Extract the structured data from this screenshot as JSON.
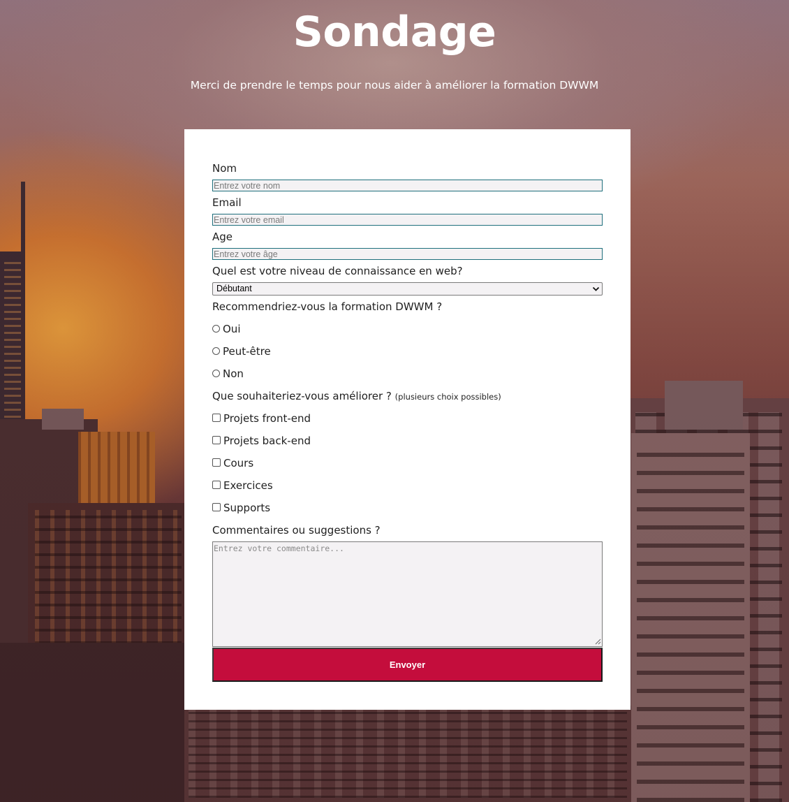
{
  "header": {
    "title": "Sondage",
    "subtitle": "Merci de prendre le temps pour nous aider à améliorer la formation DWWM"
  },
  "form": {
    "name": {
      "label": "Nom",
      "placeholder": "Entrez votre nom",
      "value": ""
    },
    "email": {
      "label": "Email",
      "placeholder": "Entrez votre email",
      "value": ""
    },
    "age": {
      "label": "Age",
      "placeholder": "Entrez votre âge",
      "value": ""
    },
    "level": {
      "label": "Quel est votre niveau de connaissance en web?",
      "selected": "Débutant",
      "icon": "chevron-down-icon"
    },
    "recommend": {
      "label": "Recommendriez-vous la formation DWWM ?",
      "options": [
        "Oui",
        "Peut-être",
        "Non"
      ]
    },
    "improve": {
      "label": "Que souhaiteriez-vous améliorer ?",
      "hint": "(plusieurs choix possibles)",
      "options": [
        "Projets front-end",
        "Projets back-end",
        "Cours",
        "Exercices",
        "Supports"
      ]
    },
    "comments": {
      "label": "Commentaires ou suggestions ?",
      "placeholder": "Entrez votre commentaire..."
    },
    "submit_label": "Envoyer"
  },
  "colors": {
    "submit_bg": "#c40d3c",
    "input_border": "#1e6f7c",
    "card_bg": "#ffffff"
  }
}
